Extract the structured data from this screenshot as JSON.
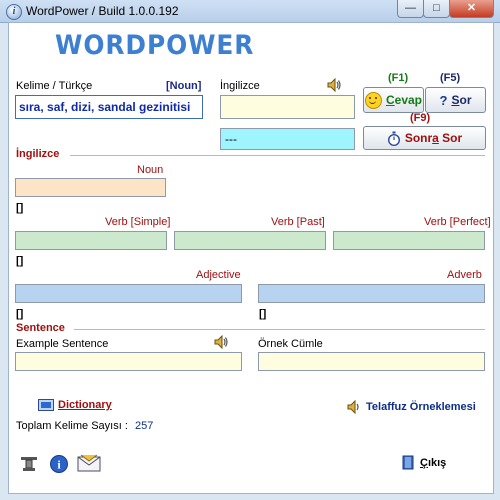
{
  "window": {
    "title": "WordPower / Build 1.0.0.192",
    "minimize": "—",
    "maximize": "□",
    "close": "✕"
  },
  "logo": "WORDPOWER",
  "kelime": {
    "label": "Kelime / Türkçe",
    "pos_tag": "[Noun]",
    "value": "sıra, saf, dizi, sandal gezinitisi"
  },
  "ingilizce": {
    "label": "İngilizce",
    "answer_value": "",
    "hint_value": "---"
  },
  "buttons": {
    "f1": "(F1)",
    "f5": "(F5)",
    "f9": "(F9)",
    "cevap_pre": "C",
    "cevap_rest": "evap",
    "sor_pre": "S",
    "sor_rest": "or",
    "sonra_sor_pre": "Sonr",
    "sonra_sor_u": "a",
    "sonra_sor_rest": " Sor",
    "cikis_pre": "Ç",
    "cikis_rest": "ıkış"
  },
  "english_section": {
    "title": "İngilizce",
    "noun_label": "Noun",
    "noun_value": "",
    "noun_brackets": "[]",
    "verb_simple_label": "Verb [Simple]",
    "verb_past_label": "Verb [Past]",
    "verb_perfect_label": "Verb [Perfect]",
    "verb_brackets": "[]",
    "adjective_label": "Adjective",
    "adverb_label": "Adverb",
    "adjective_brackets": "[]",
    "adverb_brackets": "[]"
  },
  "sentence_section": {
    "title": "Sentence",
    "example_label": "Example Sentence",
    "example_value": "",
    "ornek_label": "Örnek Cümle",
    "ornek_value": ""
  },
  "footer": {
    "dictionary": "Dictionary",
    "telaffuz": "Telaffuz Örneklemesi",
    "total_label": "Toplam Kelime Sayısı :",
    "total_value": "257"
  },
  "colors": {
    "accent_red": "#a01010",
    "accent_green": "#167a16",
    "logo_blue": "#3d7fd0",
    "answer_bg": "#fffde0",
    "hint_bg": "#9ff5ff"
  }
}
